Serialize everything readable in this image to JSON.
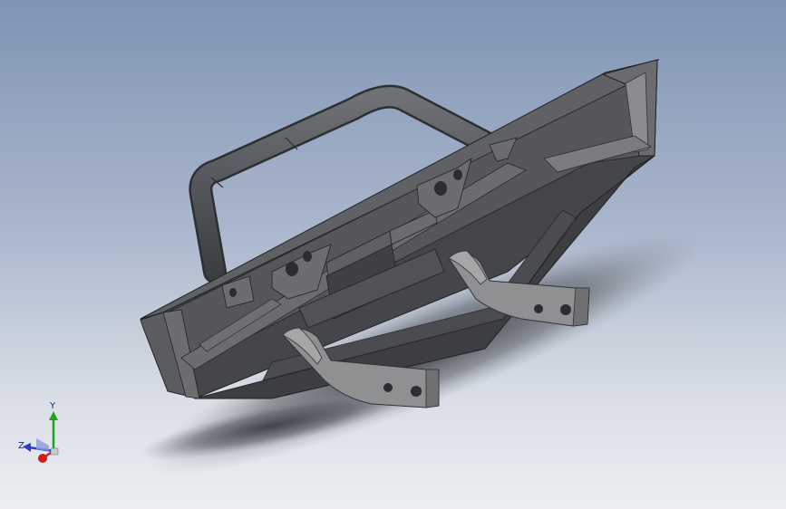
{
  "viewport": {
    "background_top": "#7f94b4",
    "background_bottom": "#eceef1"
  },
  "model": {
    "part": "front-bumper-with-hoop",
    "body_color": "#4d4f52",
    "bracket_color": "#8c8e90",
    "tube_color": "#55585c"
  },
  "triad": {
    "x_label": "",
    "y_label": "Y",
    "z_label": "Z",
    "x_color": "#d21d1d",
    "y_color": "#1fa11f",
    "z_color": "#2a3fd1"
  }
}
